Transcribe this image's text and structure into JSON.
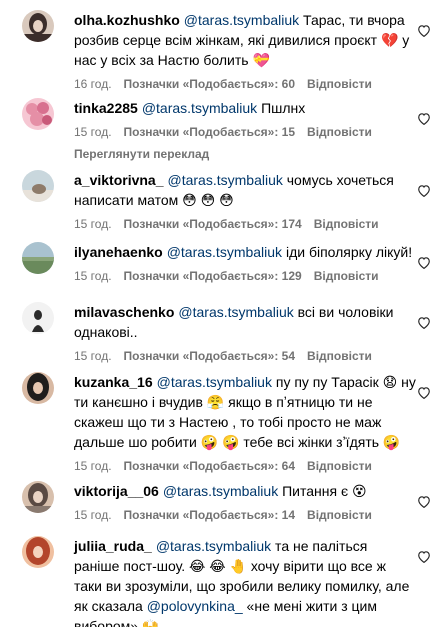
{
  "labels": {
    "likes_prefix": "Позначки «Подобається»: ",
    "reply": "Відповісти",
    "see_translation": "Переглянути переклад"
  },
  "comments": [
    {
      "username": "olha.kozhushko",
      "mention": "@taras.tsymbaliuk",
      "text": " Тарас, ти вчора розбив серце всім жінкам, які дивилися проєкт 💔 у нас у всіх за Настю болить 💝",
      "time": "16 год.",
      "likes": "Позначки «Подобається»: 60",
      "avatar_color": "#3b2d2a",
      "avatar_accent": "#d9c9bd"
    },
    {
      "username": "tinka2285",
      "mention": "@taras.tsymbaliuk",
      "text": " Пшлнх",
      "time": "15 год.",
      "likes": "Позначки «Подобається»: 15",
      "avatar_color": "#e58fa6",
      "avatar_accent": "#f6c7d3"
    },
    {
      "username": "a_viktorivna_",
      "mention": "@taras.tsymbaliuk",
      "text": " чомусь хочеться написати матом 😳 😳 😳",
      "time": "15 год.",
      "likes": "Позначки «Подобається»: 174",
      "avatar_color": "#c9d7dd",
      "avatar_accent": "#8e7b6a"
    },
    {
      "username": "ilyanehaenko",
      "mention": "@taras.tsymbaliuk",
      "text": " іди біполярку лікуй!",
      "time": "15 год.",
      "likes": "Позначки «Подобається»: 129",
      "avatar_color": "#a9c2cf",
      "avatar_accent": "#6a8a5c"
    },
    {
      "username": "milavaschenko",
      "mention": "@taras.tsymbaliuk",
      "text": " всі ви чоловіки однакові..",
      "time": "15 год.",
      "likes": "Позначки «Подобається»: 54",
      "avatar_color": "#f2f2f2",
      "avatar_accent": "#2b2b2b"
    },
    {
      "username": "kuzanka_16",
      "mention": "@taras.tsymbaliuk",
      "text": " пу пу пу Тарасік 😧 ну ти канєшно і вчудив 😤 якщо в пʼятницю ти не скажеш що ти з Настею , то тобі просто не маж дальше шо робити 🤪 🤪 тебе всі жінки зʼїдять 🤪",
      "time": "15 год.",
      "likes": "Позначки «Подобається»: 64",
      "avatar_color": "#1f1d1c",
      "avatar_accent": "#d8b9a3"
    },
    {
      "username": "viktorija__06",
      "mention": "@taras.tsymbaliuk",
      "text": " Питання є 😵",
      "time": "15 год.",
      "likes": "Позначки «Подобається»: 14",
      "avatar_color": "#5a4a43",
      "avatar_accent": "#d8c0ad"
    },
    {
      "username": "juliia_ruda_",
      "mention": "@taras.tsymbaliuk",
      "text_before": " та не паліться раніше пост-шоу. 😂 😂 🤚 хочу вірити що все ж таки ви зрозуміли, що зробили велику помилку, але як сказала ",
      "mention2": "@polovynkina_",
      "text_after": " «не мені жити з цим вибором» 🙌",
      "avatar_color": "#b3452b",
      "avatar_accent": "#f0c0a0"
    }
  ]
}
